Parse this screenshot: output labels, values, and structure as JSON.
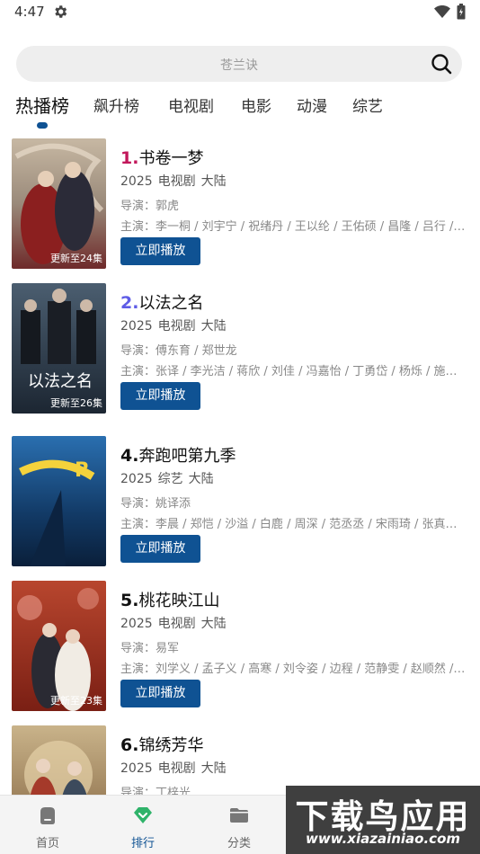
{
  "status_bar": {
    "time": "4:47"
  },
  "search": {
    "placeholder": "苍兰诀"
  },
  "tabs": [
    {
      "label": "热播榜"
    },
    {
      "label": "飙升榜"
    },
    {
      "label": "电视剧"
    },
    {
      "label": "电影"
    },
    {
      "label": "动漫"
    },
    {
      "label": "综艺"
    }
  ],
  "items": [
    {
      "rank": "1.",
      "title": "书卷一梦",
      "year": "2025",
      "type": "电视剧",
      "region": "大陆",
      "director": "导演：郭虎",
      "cast": "主演：李一桐 / 刘宇宁 / 祝绪丹 / 王以纶 / 王佑硕 / 昌隆 / 吕行 / ...",
      "update": "更新至24集",
      "play_label": "立即播放"
    },
    {
      "rank": "2.",
      "title": "以法之名",
      "year": "2025",
      "type": "电视剧",
      "region": "大陆",
      "director": "导演：傅东育 / 郑世龙",
      "cast": "主演：张译 / 李光洁 / 蒋欣 / 刘佳 / 冯嘉怡 / 丁勇岱 / 杨烁 / 施京...",
      "update": "更新至26集",
      "play_label": "立即播放"
    },
    {
      "rank": "4.",
      "title": "奔跑吧第九季",
      "year": "2025",
      "type": "综艺",
      "region": "大陆",
      "director": "导演：姚译添",
      "cast": "主演：李晨 / 郑恺 / 沙溢 / 白鹿 / 周深 / 范丞丞 / 宋雨琦 / 张真源 ...",
      "update": "",
      "play_label": "立即播放"
    },
    {
      "rank": "5.",
      "title": "桃花映江山",
      "year": "2025",
      "type": "电视剧",
      "region": "大陆",
      "director": "导演：易军",
      "cast": "主演：刘学义 / 孟子义 / 高寒 / 刘令姿 / 边程 / 范静雯 / 赵顺然 / ...",
      "update": "更新至23集",
      "play_label": "立即播放"
    },
    {
      "rank": "6.",
      "title": "锦绣芳华",
      "year": "2025",
      "type": "电视剧",
      "region": "大陆",
      "director": "导演：丁梓光",
      "cast": "",
      "update": "",
      "play_label": ""
    }
  ],
  "bottom_nav": [
    {
      "label": "首页",
      "icon": "home-icon"
    },
    {
      "label": "排行",
      "icon": "diamond-icon"
    },
    {
      "label": "分类",
      "icon": "folder-icon"
    }
  ],
  "watermark": {
    "text": "下载鸟应用",
    "url": "www.xiazainiao.com"
  },
  "colors": {
    "accent": "#0f5293",
    "rank1": "#c2185b",
    "rank2": "#5e5ce6"
  }
}
